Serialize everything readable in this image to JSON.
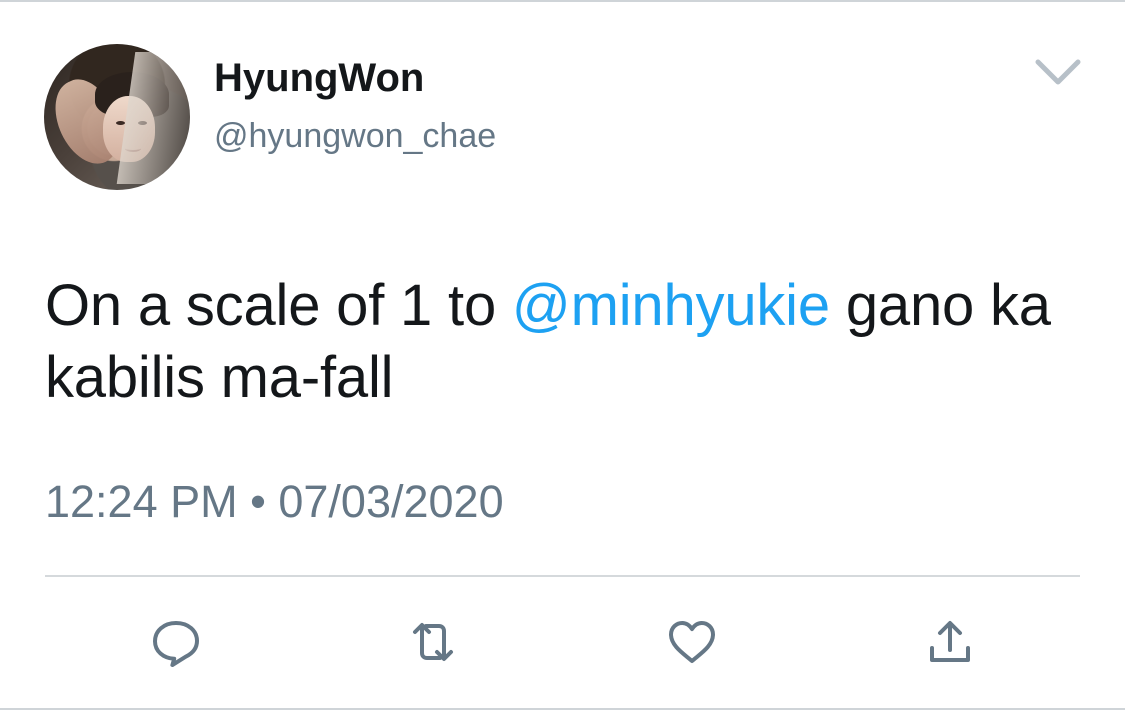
{
  "tweet": {
    "author": {
      "display_name": "HyungWon",
      "handle": "@hyungwon_chae"
    },
    "text": {
      "before_mention": "On a scale of 1 to ",
      "mention": "@minhyukie",
      "after_mention": " gano ka kabilis ma-fall"
    },
    "timestamp": "12:24 PM • 07/03/2020"
  },
  "icons": {
    "menu": "chevron-down-icon",
    "reply": "reply-icon",
    "retweet": "retweet-icon",
    "like": "heart-icon",
    "share": "share-icon"
  },
  "colors": {
    "text": "#14171a",
    "secondary": "#657786",
    "mention": "#1da1f2",
    "divider": "#d5d9dc",
    "background": "#ffffff"
  }
}
